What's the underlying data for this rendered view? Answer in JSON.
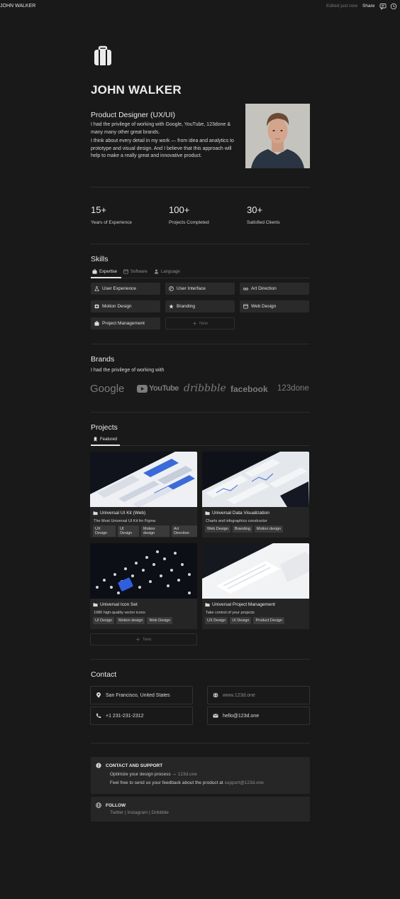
{
  "topbar": {
    "title": "JOHN WALKER",
    "edited": "Edited just now",
    "share": "Share"
  },
  "page": {
    "title": "JOHN WALKER"
  },
  "intro": {
    "title": "Product Designer (UX/UI)",
    "p1": "I had the privilege of working with Google, YouTube, 123done & many many other great brands.",
    "p2": "I think about every detail in my work — from idea and analytics to prototype and visual design. And I believe that this approach will help to make a really great and innovative product."
  },
  "stats": [
    {
      "value": "15+",
      "label": "Years of Experience"
    },
    {
      "value": "100+",
      "label": "Projects Completed"
    },
    {
      "value": "30+",
      "label": "Satisfied Clients"
    }
  ],
  "skills": {
    "title": "Skills",
    "tabs": [
      "Expertise",
      "Software",
      "Language"
    ],
    "items": [
      "User Experience",
      "User Interface",
      "Art Direction",
      "Motion Design",
      "Branding",
      "Web Design",
      "Project Management"
    ],
    "new_label": "New"
  },
  "brands": {
    "title": "Brands",
    "subtitle": "I had the privilege of working with",
    "logos": [
      "Google",
      "YouTube",
      "dribbble",
      "facebook",
      "123done"
    ]
  },
  "projects": {
    "title": "Projects",
    "tab": "Featured",
    "new_label": "New",
    "cards": [
      {
        "title": "Universal UI Kit (Web)",
        "desc": "The Most Universal UI Kit for Figma",
        "tags": [
          "UX Design",
          "UI Design",
          "Motion design",
          "Art Direction"
        ]
      },
      {
        "title": "Universal Data Visualization",
        "desc": "Charts and infographics constructor",
        "tags": [
          "Web Design",
          "Branding",
          "Motion design"
        ]
      },
      {
        "title": "Universal Icon Set",
        "desc": "1986 high-quality vector icons",
        "tags": [
          "UI Design",
          "Motion design",
          "Web Design"
        ]
      },
      {
        "title": "Universal Project Management",
        "desc": "Take control of your projects",
        "tags": [
          "UX Design",
          "UI Design",
          "Product Design"
        ]
      }
    ]
  },
  "contact": {
    "title": "Contact",
    "location": "San Francisco, United States",
    "website": "www.123d.one",
    "phone": "+1 231-231-2312",
    "email": "hello@123d.one"
  },
  "support": {
    "heading": "CONTACT AND SUPPORT",
    "line1_text": "Optimize your design process → ",
    "line1_link": "123d.one",
    "line2_text": "Feel free to send us your feedback about the product at ",
    "line2_link": "support@123d.one"
  },
  "follow": {
    "heading": "FOLLOW",
    "links": [
      "Twitter",
      "Instagram",
      "Dribbble"
    ],
    "separator": " | "
  }
}
